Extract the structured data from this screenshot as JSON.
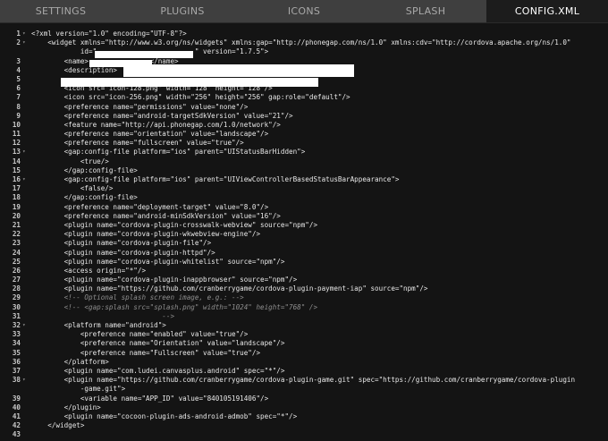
{
  "tabs": [
    {
      "label": "SETTINGS",
      "active": false
    },
    {
      "label": "PLUGINS",
      "active": false
    },
    {
      "label": "ICONS",
      "active": false
    },
    {
      "label": "SPLASH",
      "active": false
    },
    {
      "label": "CONFIG.XML",
      "active": true
    }
  ],
  "editor": {
    "lines": [
      {
        "num": "1",
        "fold": "▾",
        "text": "<?xml version=\"1.0\" encoding=\"UTF-8\"?>"
      },
      {
        "num": "2",
        "fold": "▾",
        "text": "    <widget xmlns=\"http://www.w3.org/ns/widgets\" xmlns:gap=\"http://phonegap.com/ns/1.0\" xmlns:cdv=\"http://cordova.apache.org/ns/1.0\""
      },
      {
        "num": "",
        "fold": "",
        "text": "            id=\"                        \" version=\"1.7.5\">"
      },
      {
        "num": "3",
        "fold": "",
        "text": "        <name>               </name>"
      },
      {
        "num": "4",
        "fold": "",
        "text": "        <description>"
      },
      {
        "num": "5",
        "fold": "",
        "text": ""
      },
      {
        "num": "6",
        "fold": "",
        "text": "        <icon src=\"icon-128.png\" width=\"128\" height=\"128\"/>"
      },
      {
        "num": "7",
        "fold": "",
        "text": "        <icon src=\"icon-256.png\" width=\"256\" height=\"256\" gap:role=\"default\"/>"
      },
      {
        "num": "8",
        "fold": "",
        "text": "        <preference name=\"permissions\" value=\"none\"/>"
      },
      {
        "num": "9",
        "fold": "",
        "text": "        <preference name=\"android-targetSdkVersion\" value=\"21\"/>"
      },
      {
        "num": "10",
        "fold": "",
        "text": "        <feature name=\"http://api.phonegap.com/1.0/network\"/>"
      },
      {
        "num": "11",
        "fold": "",
        "text": "        <preference name=\"orientation\" value=\"landscape\"/>"
      },
      {
        "num": "12",
        "fold": "",
        "text": "        <preference name=\"fullscreen\" value=\"true\"/>"
      },
      {
        "num": "13",
        "fold": "▾",
        "text": "        <gap:config-file platform=\"ios\" parent=\"UIStatusBarHidden\">"
      },
      {
        "num": "14",
        "fold": "",
        "text": "            <true/>"
      },
      {
        "num": "15",
        "fold": "",
        "text": "        </gap:config-file>"
      },
      {
        "num": "16",
        "fold": "▾",
        "text": "        <gap:config-file platform=\"ios\" parent=\"UIViewControllerBasedStatusBarAppearance\">"
      },
      {
        "num": "17",
        "fold": "",
        "text": "            <false/>"
      },
      {
        "num": "18",
        "fold": "",
        "text": "        </gap:config-file>"
      },
      {
        "num": "19",
        "fold": "",
        "text": "        <preference name=\"deployment-target\" value=\"8.0\"/>"
      },
      {
        "num": "20",
        "fold": "",
        "text": "        <preference name=\"android-minSdkVersion\" value=\"16\"/>"
      },
      {
        "num": "21",
        "fold": "",
        "text": "        <plugin name=\"cordova-plugin-crosswalk-webview\" source=\"npm\"/>"
      },
      {
        "num": "22",
        "fold": "",
        "text": "        <plugin name=\"cordova-plugin-wkwebview-engine\"/>"
      },
      {
        "num": "23",
        "fold": "",
        "text": "        <plugin name=\"cordova-plugin-file\"/>"
      },
      {
        "num": "24",
        "fold": "",
        "text": "        <plugin name=\"cordova-plugin-httpd\"/>"
      },
      {
        "num": "25",
        "fold": "",
        "text": "        <plugin name=\"cordova-plugin-whitelist\" source=\"npm\"/>"
      },
      {
        "num": "26",
        "fold": "",
        "text": "        <access origin=\"*\"/>"
      },
      {
        "num": "27",
        "fold": "",
        "text": "        <plugin name=\"cordova-plugin-inappbrowser\" source=\"npm\"/>"
      },
      {
        "num": "28",
        "fold": "",
        "text": "        <plugin name=\"https://github.com/cranberrygame/cordova-plugin-payment-iap\" source=\"npm\"/>"
      },
      {
        "num": "29",
        "fold": "",
        "text": "        <!-- Optional splash screen image, e.g.: -->"
      },
      {
        "num": "30",
        "fold": "",
        "text": "        <!-- <gap:splash src=\"splash.png\" width=\"1024\" height=\"768\" />"
      },
      {
        "num": "31",
        "fold": "",
        "text": "                                -->"
      },
      {
        "num": "32",
        "fold": "▾",
        "text": "        <platform name=\"android\">"
      },
      {
        "num": "33",
        "fold": "",
        "text": "            <preference name=\"enabled\" value=\"true\"/>"
      },
      {
        "num": "34",
        "fold": "",
        "text": "            <preference name=\"Orientation\" value=\"landscape\"/>"
      },
      {
        "num": "35",
        "fold": "",
        "text": "            <preference name=\"Fullscreen\" value=\"true\"/>"
      },
      {
        "num": "36",
        "fold": "",
        "text": "        </platform>"
      },
      {
        "num": "37",
        "fold": "",
        "text": "        <plugin name=\"com.ludei.canvasplus.android\" spec=\"*\"/>"
      },
      {
        "num": "38",
        "fold": "▾",
        "text": "        <plugin name=\"https://github.com/cranberrygame/cordova-plugin-game.git\" spec=\"https://github.com/cranberrygame/cordova-plugin"
      },
      {
        "num": "",
        "fold": "",
        "text": "            -game.git\">"
      },
      {
        "num": "39",
        "fold": "",
        "text": "            <variable name=\"APP_ID\" value=\"840105191406\"/>"
      },
      {
        "num": "40",
        "fold": "",
        "text": "        </plugin>"
      },
      {
        "num": "41",
        "fold": "",
        "text": "        <plugin name=\"cocoon-plugin-ads-android-admob\" spec=\"*\"/>"
      },
      {
        "num": "42",
        "fold": "",
        "text": "    </widget>"
      },
      {
        "num": "43",
        "fold": "",
        "text": ""
      }
    ]
  }
}
